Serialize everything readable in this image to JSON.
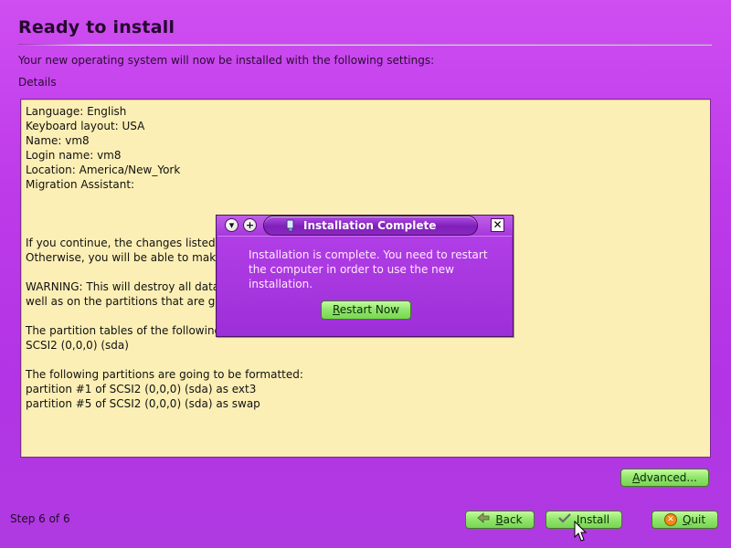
{
  "page": {
    "title": "Ready to install",
    "subtitle": "Your new operating system will now be installed with the following settings:",
    "details_label": "Details"
  },
  "details": {
    "lines": [
      "Language: English",
      "Keyboard layout: USA",
      "Name: vm8",
      "Login name: vm8",
      "Location: America/New_York",
      "Migration Assistant:",
      "",
      "",
      "",
      "If you continue, the changes listed",
      "Otherwise, you will be able to make",
      "",
      "WARNING: This will destroy all data",
      "well as on the partitions that are go",
      "",
      "The partition tables of the following",
      "SCSI2 (0,0,0) (sda)",
      "",
      "The following partitions are going to be formatted:",
      "partition #1 of SCSI2 (0,0,0) (sda) as ext3",
      "partition #5 of SCSI2 (0,0,0) (sda) as swap"
    ]
  },
  "dialog": {
    "title": "Installation Complete",
    "message": "Installation is complete. You need to restart the computer in order to use the new installation.",
    "restart_button_label": "Restart Now",
    "restart_mnemonic": "R",
    "restart_rest": "estart Now",
    "app_icon": "installer-icon",
    "minimize_icon": "minimize-icon",
    "maximize_icon": "maximize-icon",
    "close_icon": "close-icon"
  },
  "footer": {
    "step_text": "Step 6 of 6",
    "advanced_label": "Advanced...",
    "advanced_mnemonic": "A",
    "advanced_rest": "dvanced...",
    "back_label": "Back",
    "back_mnemonic": "B",
    "back_rest": "ack",
    "install_label": "Install",
    "install_mnemonic": "I",
    "install_rest": "nstall",
    "quit_label": "Quit",
    "quit_mnemonic": "Q",
    "quit_rest": "uit"
  },
  "colors": {
    "background": "#c044ee",
    "details_bg": "#fcefb5",
    "button_green": "#8fe66a",
    "dialog_purple": "#9a2fd2"
  }
}
